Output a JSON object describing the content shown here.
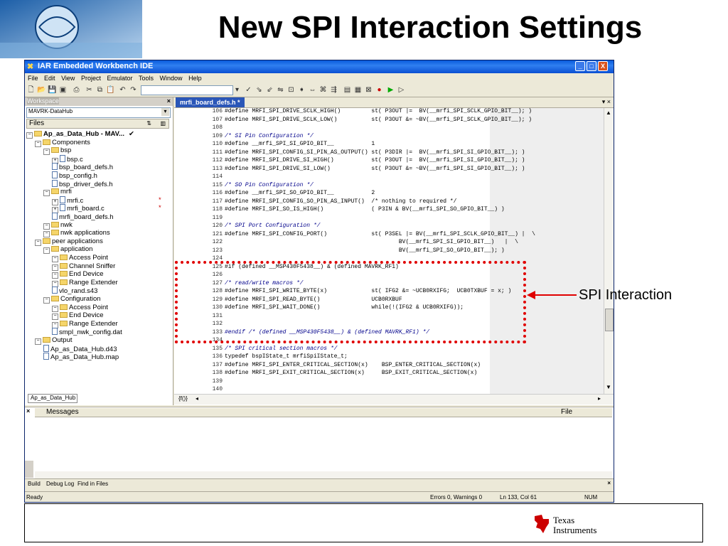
{
  "slide": {
    "title": "New SPI Interaction Settings",
    "callout_label": "SPI Interaction",
    "footer_logo_line1": "Texas",
    "footer_logo_line2": "Instruments"
  },
  "window": {
    "title": "IAR Embedded Workbench IDE",
    "minimize": "_",
    "maximize": "□",
    "close": "X"
  },
  "menu": [
    "File",
    "Edit",
    "View",
    "Project",
    "Emulator",
    "Tools",
    "Window",
    "Help"
  ],
  "workspace": {
    "header": "Workspace",
    "close": "×",
    "config": "MAVRK-DataHub",
    "files_label": "Files",
    "tab": "Ap_as_Data_Hub",
    "tree": [
      {
        "label": "Ap_as_Data_Hub - MAV...",
        "type": "project",
        "depth": 0,
        "check": "✔"
      },
      {
        "label": "Components",
        "type": "folder",
        "depth": 1
      },
      {
        "label": "bsp",
        "type": "folder",
        "depth": 2
      },
      {
        "label": "bsp.c",
        "type": "file",
        "depth": 3
      },
      {
        "label": "bsp_board_defs.h",
        "type": "file",
        "depth": 3
      },
      {
        "label": "bsp_config.h",
        "type": "file",
        "depth": 3
      },
      {
        "label": "bsp_driver_defs.h",
        "type": "file",
        "depth": 3
      },
      {
        "label": "mrfi",
        "type": "folder",
        "depth": 2
      },
      {
        "label": "mrfi.c",
        "type": "file",
        "depth": 3,
        "mark": "*"
      },
      {
        "label": "mrfi_board.c",
        "type": "file",
        "depth": 3,
        "mark": "*"
      },
      {
        "label": "mrfi_board_defs.h",
        "type": "file",
        "depth": 3
      },
      {
        "label": "nwk",
        "type": "folder",
        "depth": 2
      },
      {
        "label": "nwk applications",
        "type": "folder",
        "depth": 2
      },
      {
        "label": "peer applications",
        "type": "folder",
        "depth": 1
      },
      {
        "label": "application",
        "type": "folder",
        "depth": 2
      },
      {
        "label": "Access Point",
        "type": "folder",
        "depth": 3
      },
      {
        "label": "Channel Sniffer",
        "type": "folder",
        "depth": 3
      },
      {
        "label": "End Device",
        "type": "folder",
        "depth": 3
      },
      {
        "label": "Range Extender",
        "type": "folder",
        "depth": 3
      },
      {
        "label": "vlo_rand.s43",
        "type": "file",
        "depth": 3
      },
      {
        "label": "Configuration",
        "type": "folder",
        "depth": 2
      },
      {
        "label": "Access Point",
        "type": "folder",
        "depth": 3
      },
      {
        "label": "End Device",
        "type": "folder",
        "depth": 3
      },
      {
        "label": "Range Extender",
        "type": "folder",
        "depth": 3
      },
      {
        "label": "smpl_nwk_config.dat",
        "type": "file",
        "depth": 3
      },
      {
        "label": "Output",
        "type": "folder",
        "depth": 1
      },
      {
        "label": "Ap_as_Data_Hub.d43",
        "type": "file",
        "depth": 2
      },
      {
        "label": "Ap_as_Data_Hub.map",
        "type": "file",
        "depth": 2
      }
    ]
  },
  "editor": {
    "tab": "mrfi_board_defs.h *",
    "lines": [
      {
        "n": "106",
        "t": "#define MRFI_SPI_DRIVE_SCLK_HIGH()         st( P3OUT |=  BV(__mrfi_SPI_SCLK_GPIO_BIT__); )"
      },
      {
        "n": "107",
        "t": "#define MRFI_SPI_DRIVE_SCLK_LOW()          st( P3OUT &= ~BV(__mrfi_SPI_SCLK_GPIO_BIT__); )"
      },
      {
        "n": "108",
        "t": ""
      },
      {
        "n": "109",
        "t": "/* SI Pin Configuration */"
      },
      {
        "n": "110",
        "t": "#define __mrfi_SPI_SI_GPIO_BIT__           1"
      },
      {
        "n": "111",
        "t": "#define MRFI_SPI_CONFIG_SI_PIN_AS_OUTPUT() st( P3DIR |=  BV(__mrfi_SPI_SI_GPIO_BIT__); )"
      },
      {
        "n": "112",
        "t": "#define MRFI_SPI_DRIVE_SI_HIGH()           st( P3OUT |=  BV(__mrfi_SPI_SI_GPIO_BIT__); )"
      },
      {
        "n": "113",
        "t": "#define MRFI_SPI_DRIVE_SI_LOW()            st( P3OUT &= ~BV(__mrfi_SPI_SI_GPIO_BIT__); )"
      },
      {
        "n": "114",
        "t": ""
      },
      {
        "n": "115",
        "t": "/* SO Pin Configuration */"
      },
      {
        "n": "116",
        "t": "#define __mrfi_SPI_SO_GPIO_BIT__           2"
      },
      {
        "n": "117",
        "t": "#define MRFI_SPI_CONFIG_SO_PIN_AS_INPUT()  /* nothing to required */"
      },
      {
        "n": "118",
        "t": "#define MRFI_SPI_SO_IS_HIGH()              ( P3IN & BV(__mrfi_SPI_SO_GPIO_BIT__) )"
      },
      {
        "n": "119",
        "t": ""
      },
      {
        "n": "120",
        "t": "/* SPI Port Configuration */"
      },
      {
        "n": "121",
        "t": "#define MRFI_SPI_CONFIG_PORT()             st( P3SEL |= BV(__mrfi_SPI_SCLK_GPIO_BIT__) |  \\"
      },
      {
        "n": "122",
        "t": "                                                   BV(__mrfi_SPI_SI_GPIO_BIT__)   |  \\"
      },
      {
        "n": "123",
        "t": "                                                   BV(__mrfi_SPI_SO_GPIO_BIT__); )"
      },
      {
        "n": "124",
        "t": ""
      },
      {
        "n": "125",
        "t": "#if (defined __MSP430F5438__) & (defined MAVRK_RF1)"
      },
      {
        "n": "126",
        "t": ""
      },
      {
        "n": "127",
        "t": "/* read/write macros */"
      },
      {
        "n": "128",
        "t": "#define MRFI_SPI_WRITE_BYTE(x)             st( IFG2 &= ~UCB0RXIFG;  UCB0TXBUF = x; )"
      },
      {
        "n": "129",
        "t": "#define MRFI_SPI_READ_BYTE()               UCB0RXBUF"
      },
      {
        "n": "130",
        "t": "#define MRFI_SPI_WAIT_DONE()               while(!(IFG2 & UCB0RXIFG));"
      },
      {
        "n": "131",
        "t": ""
      },
      {
        "n": "132",
        "t": ""
      },
      {
        "n": "133",
        "t": "#endif /* (defined __MSP430F5438__) & (defined MAVRK_RF1) */"
      },
      {
        "n": "134",
        "t": ""
      },
      {
        "n": "135",
        "t": "/* SPI critical section macros */"
      },
      {
        "n": "136",
        "t": "typedef bspIState_t mrfiSpiIState_t;"
      },
      {
        "n": "137",
        "t": "#define MRFI_SPI_ENTER_CRITICAL_SECTION(x)    BSP_ENTER_CRITICAL_SECTION(x)"
      },
      {
        "n": "138",
        "t": "#define MRFI_SPI_EXIT_CRITICAL_SECTION(x)     BSP_EXIT_CRITICAL_SECTION(x)"
      },
      {
        "n": "139",
        "t": ""
      },
      {
        "n": "140",
        "t": ""
      }
    ]
  },
  "messages": {
    "col_messages": "Messages",
    "col_file": "File"
  },
  "bottom_tabs": [
    "Build",
    "Debug Log",
    "Find in Files"
  ],
  "status": {
    "ready": "Ready",
    "errors": "Errors 0, Warnings 0",
    "position": "Ln 133, Col 61",
    "num": "NUM"
  }
}
